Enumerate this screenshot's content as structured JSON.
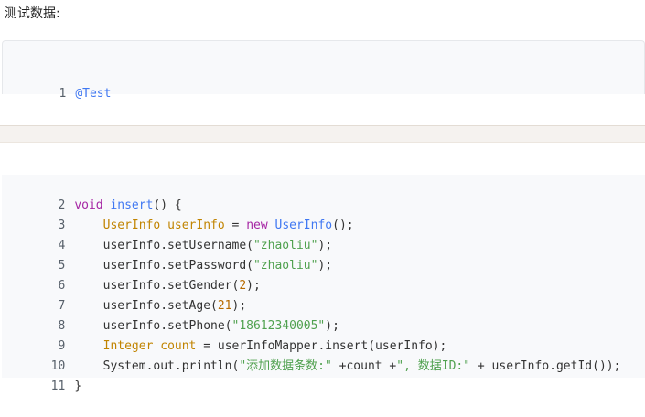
{
  "heading": "测试数据:",
  "code_block_1": {
    "lines": [
      {
        "num": "1",
        "text": "@Test"
      }
    ]
  },
  "code_block_2": {
    "lines": [
      {
        "num": "2",
        "p1": "void",
        "p2": " ",
        "p3": "insert",
        "p4": "() {"
      },
      {
        "num": "3",
        "p1": "    ",
        "p2": "UserInfo",
        "p3": " ",
        "p4": "userInfo",
        "p5": " = ",
        "p6": "new",
        "p7": " ",
        "p8": "UserInfo",
        "p9": "();"
      },
      {
        "num": "4",
        "p1": "    userInfo.setUsername(",
        "p2": "\"zhaoliu\"",
        "p3": ");"
      },
      {
        "num": "5",
        "p1": "    userInfo.setPassword(",
        "p2": "\"zhaoliu\"",
        "p3": ");"
      },
      {
        "num": "6",
        "p1": "    userInfo.setGender(",
        "p2": "2",
        "p3": ");"
      },
      {
        "num": "7",
        "p1": "    userInfo.setAge(",
        "p2": "21",
        "p3": ");"
      },
      {
        "num": "8",
        "p1": "    userInfo.setPhone(",
        "p2": "\"18612340005\"",
        "p3": ");"
      },
      {
        "num": "9",
        "p1": "    ",
        "p2": "Integer",
        "p3": " ",
        "p4": "count",
        "p5": " = userInfoMapper.insert(userInfo);"
      },
      {
        "num": "10",
        "p1": "    System.out.println(",
        "p2": "\"添加数据条数:\"",
        "p3": " +count +",
        "p4": "\", 数据ID:\"",
        "p5": " + userInfo.getId());"
      },
      {
        "num": "11",
        "p1": "}"
      }
    ]
  }
}
